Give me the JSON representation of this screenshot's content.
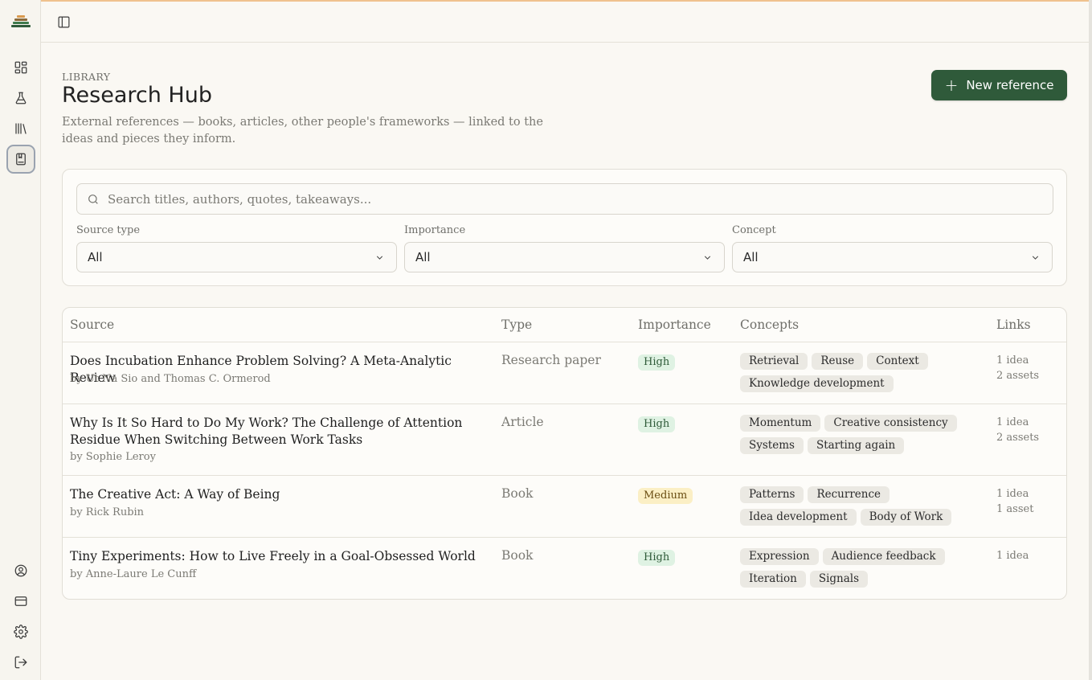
{
  "header": {
    "eyebrow": "LIBRARY",
    "title": "Research Hub",
    "subtitle": "External references — books, articles, other people's frameworks — linked to the ideas and pieces they inform.",
    "new_button_label": "New reference"
  },
  "sidebar": {
    "logo_colors": [
      "#d99a4e",
      "#8a6a3c",
      "#3f7a4d",
      "#2f5a3a"
    ],
    "items": [
      {
        "icon": "dashboard-icon"
      },
      {
        "icon": "flask-icon"
      },
      {
        "icon": "library-icon"
      },
      {
        "icon": "book-icon",
        "active": true
      }
    ],
    "bottom_items": [
      {
        "icon": "user-circle-icon"
      },
      {
        "icon": "credit-card-icon"
      },
      {
        "icon": "gear-icon"
      },
      {
        "icon": "logout-icon"
      }
    ]
  },
  "filters": {
    "search_placeholder": "Search titles, authors, quotes, takeaways...",
    "source_type": {
      "label": "Source type",
      "value": "All"
    },
    "importance": {
      "label": "Importance",
      "value": "All"
    },
    "concept": {
      "label": "Concept",
      "value": "All"
    }
  },
  "table": {
    "columns": [
      "Source",
      "Type",
      "Importance",
      "Concepts",
      "Links"
    ],
    "rows": [
      {
        "title": "Does Incubation Enhance Problem Solving? A Meta-Analytic Review",
        "author": "by Ut Na Sio and Thomas C. Ormerod",
        "type": "Research paper",
        "importance": "High",
        "concepts": [
          "Retrieval",
          "Reuse",
          "Context",
          "Knowledge development"
        ],
        "links": [
          "1 idea",
          "2 assets"
        ]
      },
      {
        "title": "Why Is It So Hard to Do My Work? The Challenge of Attention Residue When Switching Between Work Tasks",
        "author": "by Sophie Leroy",
        "type": "Article",
        "importance": "High",
        "concepts": [
          "Momentum",
          "Creative consistency",
          "Systems",
          "Starting again"
        ],
        "links": [
          "1 idea",
          "2 assets"
        ]
      },
      {
        "title": "The Creative Act: A Way of Being",
        "author": "by Rick Rubin",
        "type": "Book",
        "importance": "Medium",
        "concepts": [
          "Patterns",
          "Recurrence",
          "Idea development",
          "Body of Work"
        ],
        "links": [
          "1 idea",
          "1 asset"
        ]
      },
      {
        "title": "Tiny Experiments: How to Live Freely in a Goal-Obsessed World",
        "author": "by Anne-Laure Le Cunff",
        "type": "Book",
        "importance": "High",
        "concepts": [
          "Expression",
          "Audience feedback",
          "Iteration",
          "Signals"
        ],
        "links": [
          "1 idea"
        ]
      }
    ]
  },
  "colors": {
    "accent": "#2f5a3a",
    "high_badge": "#dff2e3",
    "medium_badge": "#fbefc5"
  }
}
